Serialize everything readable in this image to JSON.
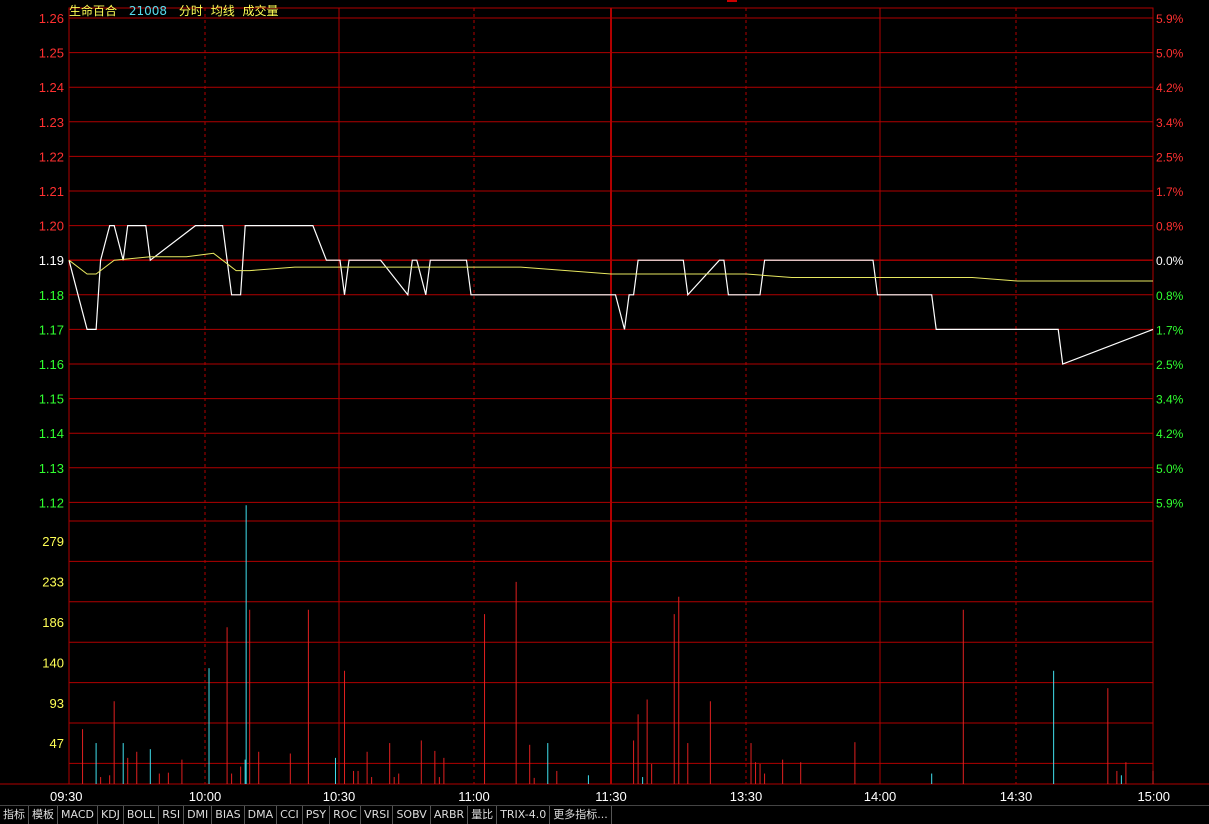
{
  "header": {
    "stock_name": "生命百合",
    "code": "21008",
    "labels": [
      "分时",
      "均线",
      "成交量"
    ]
  },
  "colors": {
    "grid": "#b00000",
    "price": "#ffffff",
    "avg": "#e8e860",
    "up": "#ff3030",
    "down": "#30ff30",
    "flat": "#ffffff",
    "volume_up": "#e02020",
    "volume_down": "#40e0ee",
    "volume_label": "#ffff55"
  },
  "chart_data": [
    {
      "type": "line",
      "title": "",
      "xlabel": "",
      "ylabel": "",
      "x_ticks": [
        "09:30",
        "10:00",
        "10:30",
        "11:00",
        "11:30",
        "13:30",
        "14:00",
        "14:30",
        "15:00"
      ],
      "y_ticks": [
        "1.26",
        "1.25",
        "1.24",
        "1.23",
        "1.22",
        "1.21",
        "1.20",
        "1.19",
        "1.18",
        "1.17",
        "1.16",
        "1.15",
        "1.14",
        "1.13",
        "1.12"
      ],
      "y_right_ticks": [
        "5.9%",
        "5.0%",
        "4.2%",
        "3.4%",
        "2.5%",
        "1.7%",
        "0.8%",
        "0.0%",
        "0.8%",
        "1.7%",
        "2.5%",
        "3.4%",
        "4.2%",
        "5.0%",
        "5.9%"
      ],
      "ylim": [
        1.12,
        1.26
      ],
      "prev_close": 1.19,
      "series": [
        {
          "x": [
            0,
            2,
            4,
            6,
            7,
            9,
            10,
            12,
            13,
            15,
            17,
            18,
            28,
            29,
            34,
            35,
            36,
            38,
            39,
            42,
            54,
            57,
            60,
            61,
            62,
            64,
            69,
            75,
            76,
            77,
            79,
            80,
            88,
            89,
            90,
            92,
            93,
            104,
            105,
            121,
            123,
            124,
            125,
            126,
            136,
            137,
            144,
            145,
            146,
            147,
            153,
            154,
            178,
            179,
            191,
            192,
            197,
            198,
            219,
            220,
            240
          ],
          "values": [
            1.19,
            1.18,
            1.17,
            1.17,
            1.19,
            1.2,
            1.2,
            1.19,
            1.2,
            1.2,
            1.2,
            1.19,
            1.2,
            1.2,
            1.2,
            1.19,
            1.18,
            1.18,
            1.2,
            1.2,
            1.2,
            1.19,
            1.19,
            1.18,
            1.19,
            1.19,
            1.19,
            1.18,
            1.19,
            1.19,
            1.18,
            1.19,
            1.19,
            1.18,
            1.18,
            1.18,
            1.18,
            1.18,
            1.18,
            1.18,
            1.17,
            1.18,
            1.18,
            1.19,
            1.19,
            1.18,
            1.19,
            1.19,
            1.18,
            1.18,
            1.18,
            1.19,
            1.19,
            1.18,
            1.18,
            1.17,
            1.17,
            1.17,
            1.17,
            1.16,
            1.17
          ]
        },
        {
          "x": [
            0,
            4,
            6,
            10,
            18,
            26,
            32,
            35,
            37,
            40,
            50,
            60,
            80,
            100,
            120,
            140,
            150,
            160,
            180,
            200,
            210,
            230,
            240
          ],
          "values": [
            1.19,
            1.186,
            1.186,
            1.19,
            1.191,
            1.191,
            1.192,
            1.189,
            1.187,
            1.187,
            1.188,
            1.188,
            1.188,
            1.188,
            1.186,
            1.186,
            1.186,
            1.185,
            1.185,
            1.185,
            1.184,
            1.184,
            1.184
          ]
        }
      ]
    },
    {
      "type": "bar",
      "title": "",
      "xlabel": "",
      "ylabel": "",
      "y_ticks": [
        "279",
        "233",
        "186",
        "140",
        "93",
        "47"
      ],
      "ylim": [
        0,
        300
      ],
      "x": [
        3,
        6,
        7,
        9,
        10,
        12,
        13,
        15,
        18,
        20,
        22,
        25,
        31,
        35,
        36,
        38,
        39,
        40,
        42,
        49,
        53,
        59,
        61,
        63,
        64,
        66,
        67,
        71,
        72,
        73,
        78,
        81,
        82,
        83,
        92,
        99,
        102,
        103,
        106,
        108,
        115,
        125,
        126,
        127,
        128,
        129,
        134,
        135,
        137,
        142,
        151,
        152,
        153,
        154,
        158,
        162,
        174,
        191,
        198,
        218,
        230,
        232,
        233,
        234,
        240
      ],
      "values": [
        63,
        47,
        8,
        10,
        95,
        47,
        30,
        37,
        40,
        12,
        13,
        28,
        133,
        180,
        12,
        20,
        28,
        200,
        37,
        35,
        200,
        30,
        130,
        15,
        15,
        37,
        8,
        47,
        8,
        12,
        50,
        38,
        8,
        30,
        195,
        232,
        45,
        7,
        47,
        15,
        10,
        50,
        80,
        8,
        97,
        23,
        195,
        215,
        47,
        95,
        47,
        25,
        23,
        12,
        28,
        25,
        48,
        12,
        200,
        130,
        110,
        15,
        10,
        25,
        15
      ],
      "directions": [
        "u",
        "d",
        "u",
        "u",
        "u",
        "d",
        "u",
        "u",
        "d",
        "u",
        "u",
        "u",
        "d",
        "u",
        "u",
        "u",
        "d",
        "u",
        "u",
        "u",
        "u",
        "d",
        "u",
        "u",
        "u",
        "u",
        "u",
        "u",
        "u",
        "u",
        "u",
        "u",
        "u",
        "u",
        "u",
        "u",
        "u",
        "u",
        "d",
        "u",
        "d",
        "u",
        "u",
        "d",
        "u",
        "u",
        "u",
        "u",
        "u",
        "u",
        "u",
        "u",
        "u",
        "u",
        "u",
        "u",
        "u",
        "d",
        "u",
        "d",
        "u",
        "u",
        "d",
        "u",
        "u"
      ]
    }
  ],
  "highlight_volume_bar": {
    "x": 39,
    "value": 320
  },
  "toolbar": {
    "tabs": [
      "指标",
      "模板",
      "MACD",
      "KDJ",
      "BOLL",
      "RSI",
      "DMI",
      "BIAS",
      "DMA",
      "CCI",
      "PSY",
      "ROC",
      "VRSI",
      "SOBV",
      "ARBR",
      "量比",
      "TRIX-4.0",
      "更多指标..."
    ]
  }
}
